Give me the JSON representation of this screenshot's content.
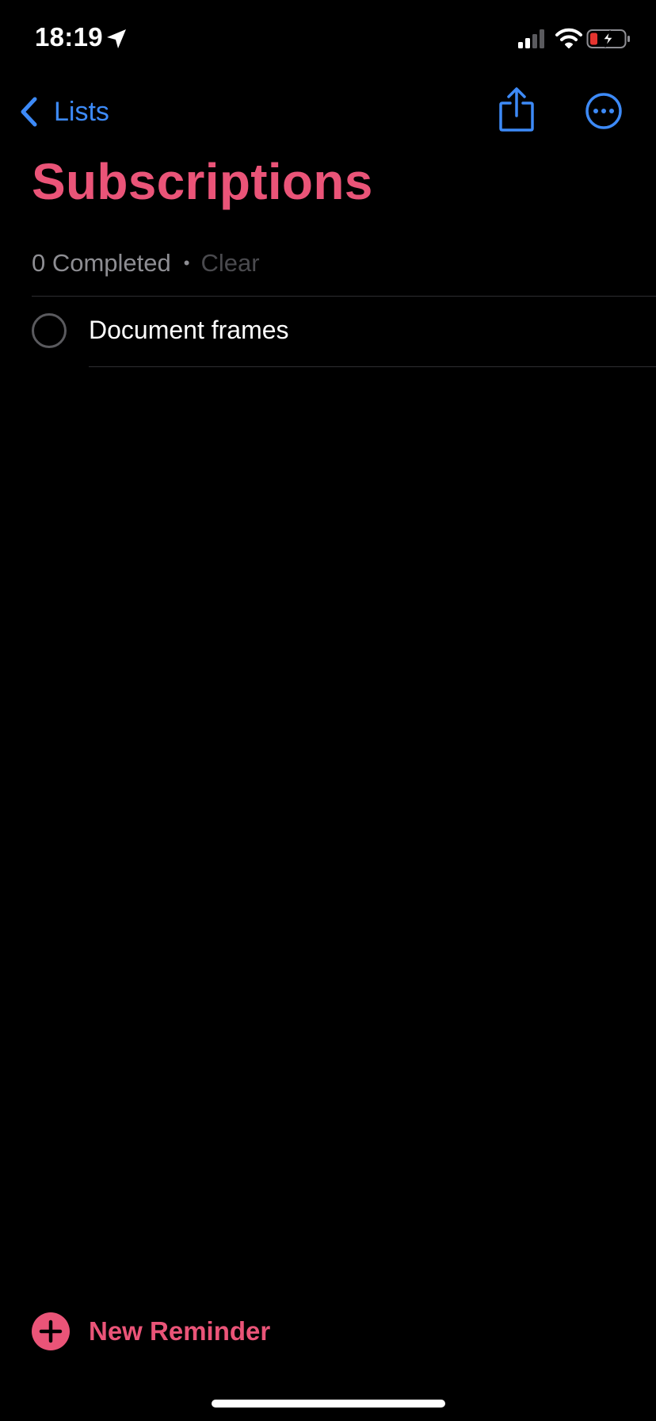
{
  "status_bar": {
    "time": "18:19",
    "icons": [
      "location-arrow-icon",
      "cellular-signal-icon",
      "wifi-icon",
      "battery-charging-icon"
    ]
  },
  "nav": {
    "back_label": "Lists",
    "back_icon": "chevron-left-icon",
    "share_icon": "share-icon",
    "more_icon": "ellipsis-circle-icon"
  },
  "list": {
    "title": "Subscriptions",
    "completed_text": "0 Completed",
    "separator": "•",
    "clear_label": "Clear",
    "items": [
      {
        "title": "Document frames",
        "completed": false
      }
    ]
  },
  "footer": {
    "new_reminder_label": "New Reminder",
    "new_reminder_icon": "plus-circle-icon"
  },
  "colors": {
    "accent": "#ea5478",
    "link": "#3d8af7",
    "background": "#000000",
    "secondary_text": "#8e8e93",
    "battery_low": "#e5342f"
  }
}
